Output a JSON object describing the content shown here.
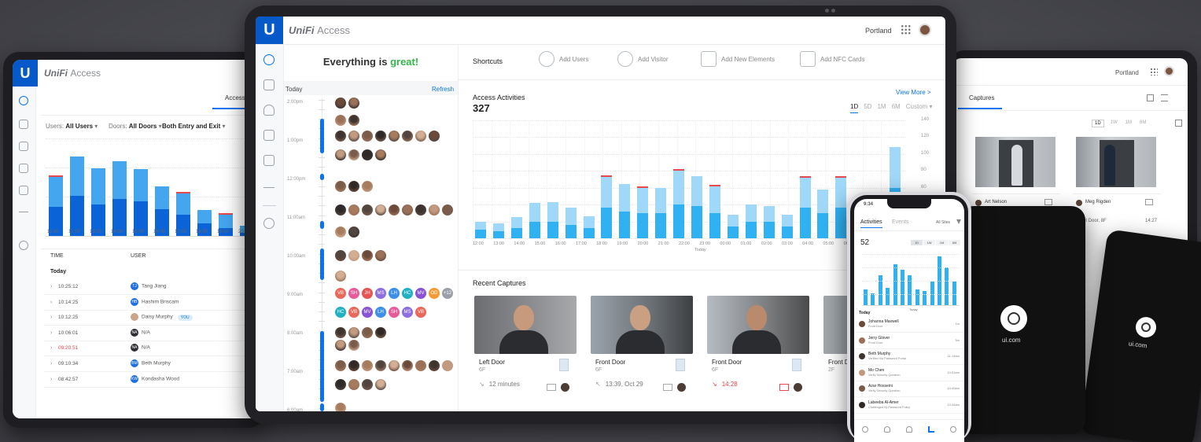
{
  "brand": {
    "logo": "U",
    "name": "UniFi",
    "product": "Access"
  },
  "left": {
    "tab": "Access L",
    "filters": [
      {
        "label": "Users:",
        "value": "All Users"
      },
      {
        "label": "Doors:",
        "value": "All Doors"
      },
      {
        "label": "",
        "value": "Both Entry and Exit"
      }
    ],
    "chart": {
      "labels": [
        "11:00",
        "12:00",
        "13:00",
        "14:00",
        "15:00",
        "16:00",
        "17:00",
        "18:00",
        "19:00",
        "20"
      ],
      "light": [
        68,
        92,
        78,
        86,
        77,
        57,
        49,
        30,
        25,
        12
      ],
      "dark": [
        34,
        46,
        36,
        43,
        40,
        31,
        25,
        15,
        9,
        4
      ],
      "red": [
        true,
        false,
        false,
        false,
        false,
        false,
        true,
        false,
        true,
        false
      ]
    },
    "table": {
      "headers": [
        "TIME",
        "USER"
      ],
      "group": "Today",
      "rows": [
        {
          "time": "10:25:12",
          "user": "Tang Jiang",
          "initials": "TJ",
          "color": "#1f6fe0",
          "alert": false,
          "badge": ""
        },
        {
          "time": "10:14:25",
          "user": "Hashim Briscam",
          "initials": "HB",
          "color": "#1f6fe0",
          "alert": false,
          "badge": ""
        },
        {
          "time": "10:12:25",
          "user": "Daisy Murphy",
          "initials": "",
          "color": "#c9a58a",
          "alert": false,
          "badge": "YOU"
        },
        {
          "time": "10:06:01",
          "user": "N/A",
          "initials": "NA",
          "color": "#2d2d33",
          "alert": false,
          "badge": ""
        },
        {
          "time": "09:20:51",
          "user": "N/A",
          "initials": "NA",
          "color": "#2d2d33",
          "alert": true,
          "badge": ""
        },
        {
          "time": "09:10:34",
          "user": "Beth Murphy",
          "initials": "BM",
          "color": "#1f6fe0",
          "alert": false,
          "badge": ""
        },
        {
          "time": "08:42:57",
          "user": "Kondasha Wood",
          "initials": "KW",
          "color": "#1f6fe0",
          "alert": false,
          "badge": ""
        }
      ]
    }
  },
  "main": {
    "location": "Portland",
    "status": {
      "prefix": "Everything is ",
      "highlight": "great!"
    },
    "timeline": {
      "today": "Today",
      "refresh": "Refresh",
      "times": [
        "2:00pm",
        "1:00pm",
        "12:00pm",
        "11:00am",
        "10:00am",
        "9:00am",
        "8:00am",
        "7:00am",
        "6:00am"
      ]
    },
    "avatar_rows": [
      {
        "n": 2
      },
      {
        "n": 2
      },
      {
        "n": 8
      },
      {
        "n": 4
      },
      {
        "n": 3
      },
      {
        "n": 9
      },
      {
        "n": 2
      },
      {
        "n": 4
      },
      {
        "n": 1
      },
      {
        "labels": [
          "VB",
          "SH",
          "JH",
          "MS",
          "LH",
          "HC",
          "MV",
          "OD",
          "+12"
        ]
      },
      {
        "labels": [
          "HC",
          "VB",
          "MV",
          "LH",
          "SH",
          "MS",
          "VB"
        ]
      },
      {
        "n": 4
      },
      {
        "n": 2
      },
      {
        "n": 9
      },
      {
        "n": 4
      },
      {
        "n": 1
      }
    ],
    "letter_colors": {
      "VB": "#e96a5b",
      "SH": "#e85b9a",
      "JH": "#e85454",
      "MS": "#8d6fe0",
      "LH": "#3d8fe8",
      "HC": "#21b1c2",
      "MV": "#8a53d6",
      "OD": "#f29c38",
      "+12": "#9aa0a8"
    },
    "shortcuts": {
      "title": "Shortcuts",
      "items": [
        "Add Users",
        "Add Visitor",
        "Add New Elements",
        "Add NFC Cards"
      ]
    },
    "activities": {
      "title": "Access Activities",
      "count": "327",
      "view_more": "View More >",
      "ranges": [
        "1D",
        "5D",
        "1M",
        "6M",
        "Custom"
      ],
      "active_range": "1D",
      "today": "Today"
    },
    "chart_data": {
      "type": "bar",
      "title": "Access Activities",
      "categories": [
        "12:00",
        "13:00",
        "14:00",
        "15:00",
        "16:00",
        "17:00",
        "18:00",
        "19:00",
        "20:00",
        "21:00",
        "22:00",
        "23:00",
        "00:00",
        "01:00",
        "02:00",
        "03:00",
        "04:00",
        "05:00",
        "06:00",
        "07:00",
        "08:00"
      ],
      "series": [
        {
          "name": "",
          "values": [
            20,
            18,
            25,
            42,
            43,
            36,
            26,
            73,
            64,
            60,
            60,
            80,
            74,
            62,
            28,
            40,
            38,
            28,
            72,
            58,
            72,
            38,
            26,
            108
          ]
        },
        {
          "name": "",
          "values": [
            10,
            8,
            12,
            20,
            20,
            16,
            12,
            36,
            32,
            30,
            30,
            40,
            38,
            30,
            14,
            20,
            20,
            14,
            36,
            30,
            36,
            20,
            14,
            60
          ]
        }
      ],
      "ymax": 140,
      "yticks": [
        140,
        120,
        100,
        80,
        60,
        40,
        20,
        0
      ]
    },
    "captures": {
      "title": "Recent Captures",
      "items": [
        {
          "name": "Left Door",
          "floor": "6F",
          "time": "12 minutes",
          "alert": false,
          "exit": false
        },
        {
          "name": "Front Door",
          "floor": "6F",
          "time": "13:39, Oct 29",
          "alert": false,
          "exit": true
        },
        {
          "name": "Front Door",
          "floor": "6F",
          "time": "14:28",
          "alert": true,
          "exit": false
        },
        {
          "name": "Front D",
          "floor": "2F",
          "time": "",
          "alert": false,
          "exit": false
        }
      ]
    }
  },
  "right": {
    "location": "Portland",
    "tab": "Captures",
    "ranges": [
      "1D",
      "1W",
      "1M",
      "6M"
    ],
    "captures": [
      {
        "name": "Art Nelson",
        "door": "Front Door, 8F",
        "time": "14:27"
      },
      {
        "name": "Meg Rigden",
        "door": "Front Door, 8F",
        "time": "14:27"
      }
    ]
  },
  "phone": {
    "time": "9:34",
    "tabs": [
      "Activities",
      "Events"
    ],
    "filter": "All Sites",
    "count": "52",
    "ranges": [
      "1D",
      "1W",
      "1M",
      "6M"
    ],
    "bars": [
      20,
      15,
      38,
      22,
      52,
      45,
      38,
      20,
      18,
      30,
      62,
      48,
      30
    ],
    "today": "Today",
    "group": "Today",
    "items": [
      {
        "name": "Johanna Maxwell",
        "desc": "Front Door",
        "time": "1m"
      },
      {
        "name": "Jerry Glover",
        "desc": "Front Door",
        "time": "5m"
      },
      {
        "name": "Beth Murphy",
        "desc": "Verified Via Password Portal",
        "time": "11:14am"
      },
      {
        "name": "Mo Chen",
        "desc": "Verify Security Question",
        "time": "10:51am"
      },
      {
        "name": "Azar Hosseini",
        "desc": "Verify Security Question",
        "time": "10:40am"
      },
      {
        "name": "Labeeba Al-Amer",
        "desc": "Challenged by Password Policy",
        "time": "10:34am"
      }
    ]
  },
  "cards": [
    {
      "label": "ui.com"
    },
    {
      "label": "ui.com"
    }
  ]
}
